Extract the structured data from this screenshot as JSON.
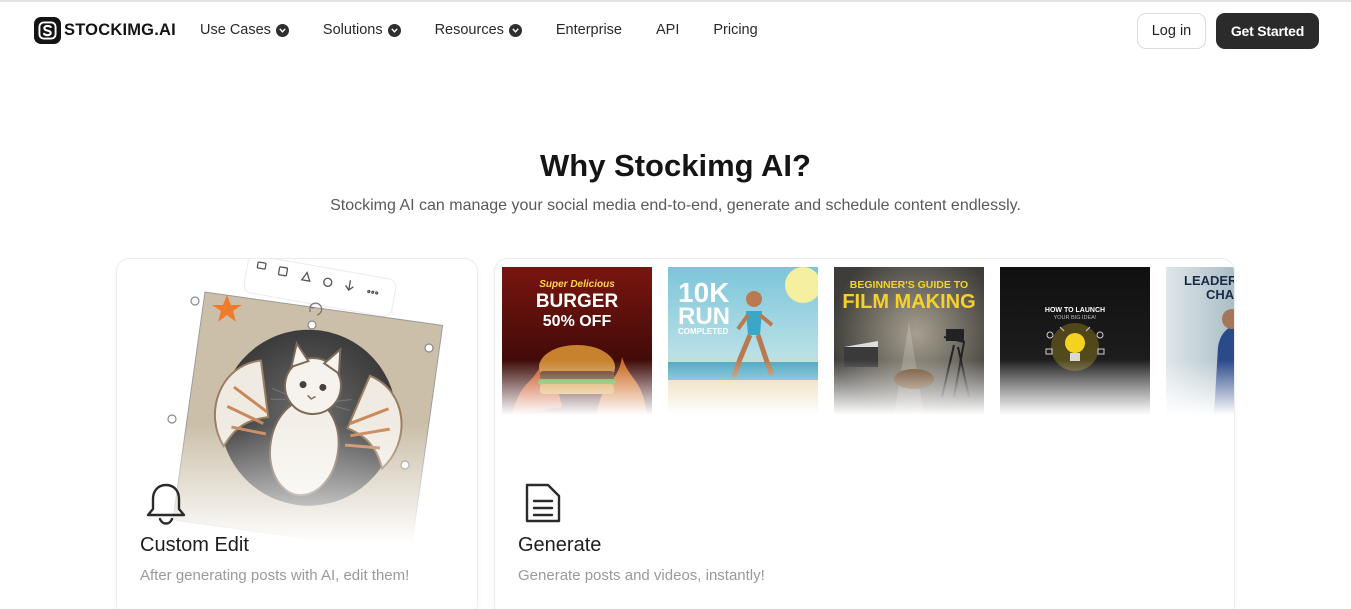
{
  "brand": {
    "name": "STOCKIMG.AI",
    "logo_letter": "S"
  },
  "nav": {
    "items": [
      {
        "label": "Use Cases",
        "has_dropdown": true
      },
      {
        "label": "Solutions",
        "has_dropdown": true
      },
      {
        "label": "Resources",
        "has_dropdown": true
      },
      {
        "label": "Enterprise",
        "has_dropdown": false
      },
      {
        "label": "API",
        "has_dropdown": false
      },
      {
        "label": "Pricing",
        "has_dropdown": false
      }
    ],
    "login_label": "Log in",
    "cta_label": "Get Started"
  },
  "hero": {
    "title": "Why Stockimg AI?",
    "subtitle": "Stockimg AI can manage your social media end-to-end, generate and schedule content endlessly."
  },
  "features": [
    {
      "title": "Custom Edit",
      "description": "After generating posts with AI, edit them!",
      "icon": "bell-icon"
    },
    {
      "title": "Generate",
      "description": "Generate posts and videos, instantly!",
      "icon": "document-icon"
    }
  ],
  "thumbnails": [
    {
      "line1": "Super Delicious",
      "line2": "BURGER",
      "line3": "50% OFF"
    },
    {
      "line1": "10K",
      "line2": "RUN",
      "line3": "COMPLETED"
    },
    {
      "line1": "BEGINNER'S GUIDE TO",
      "line2": "FILM MAKING"
    },
    {
      "line1": "HOW TO LAUNCH",
      "line2": "YOUR BIG IDEA!"
    },
    {
      "line1": "LEADERS",
      "line2": "CHA"
    }
  ],
  "colors": {
    "cta": "#2b2b2b",
    "star": "#f07b2a",
    "accent_yellow": "#f5d21f"
  }
}
